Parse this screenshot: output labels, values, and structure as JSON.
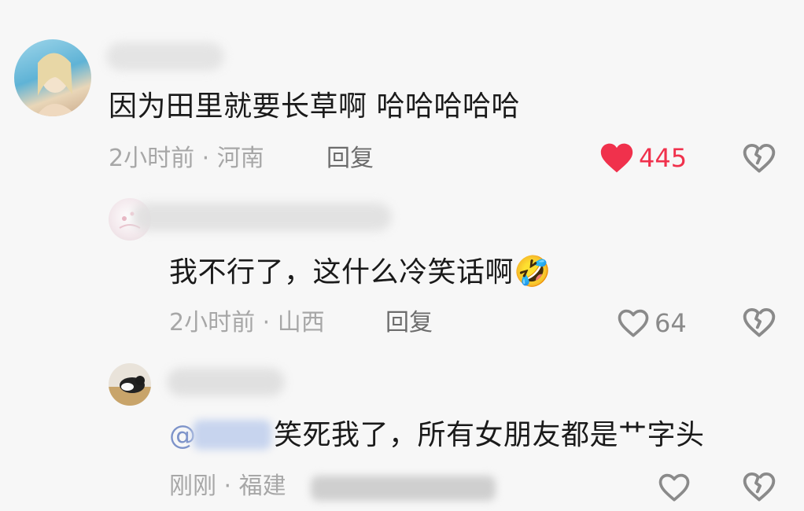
{
  "comments": [
    {
      "text": "因为田里就要长草啊  哈哈哈哈哈",
      "meta": "2小时前 · 河南",
      "reply_label": "回复",
      "like_count": "445",
      "liked": true
    },
    {
      "text": "我不行了，这什么冷笑话啊",
      "emoji": "🤣",
      "meta": "2小时前 · 山西",
      "reply_label": "回复",
      "like_count": "64",
      "liked": false
    },
    {
      "mention": "@",
      "text": "笑死我了，所有女朋友都是艹字头",
      "meta": "刚刚 · 福建",
      "like_count": "",
      "liked": false
    }
  ],
  "colors": {
    "liked_red": "#f0314c",
    "icon_gray": "#8a8a8a",
    "meta_gray": "#a7a7a7"
  },
  "icons": {
    "like": "heart-icon",
    "dislike": "broken-heart-icon"
  }
}
